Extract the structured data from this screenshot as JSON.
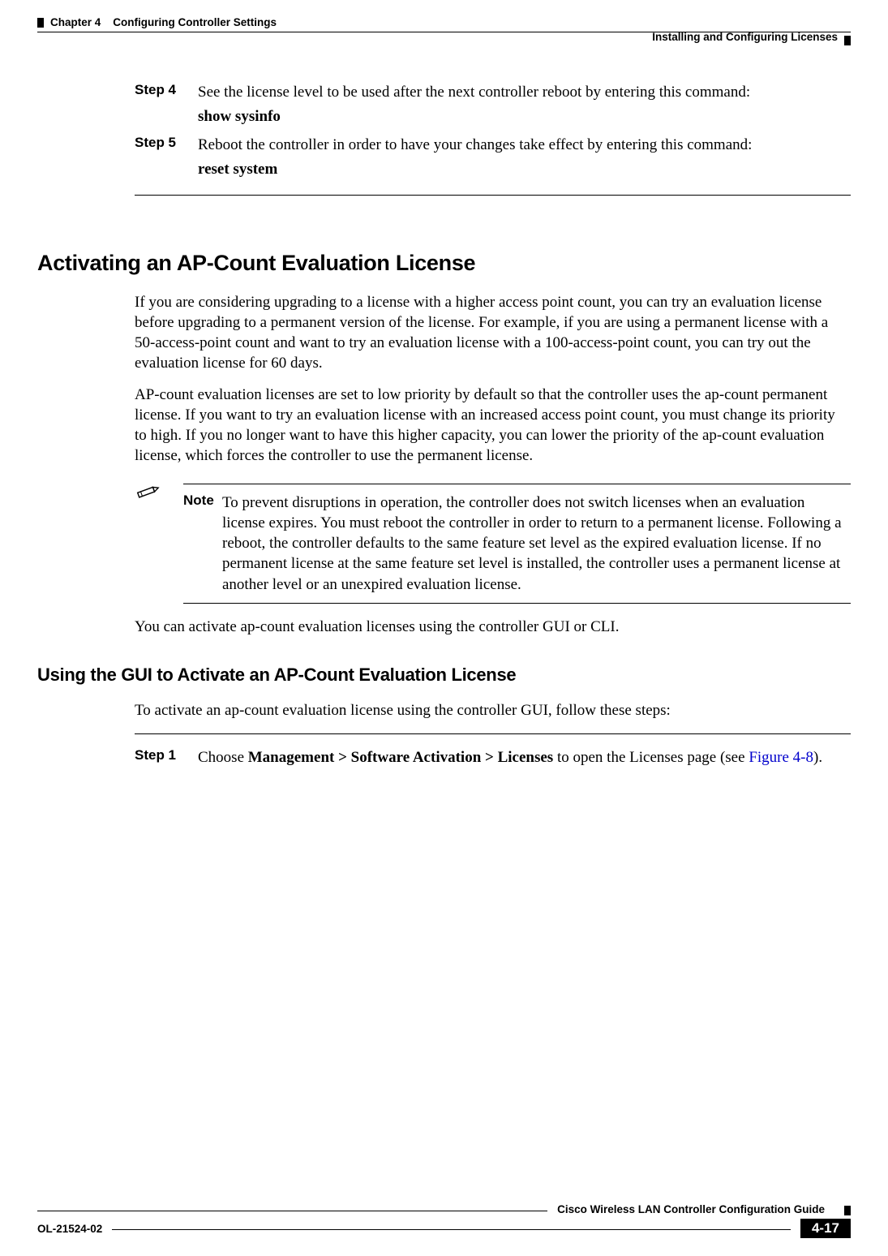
{
  "header": {
    "chapter_label": "Chapter 4",
    "chapter_title": "Configuring Controller Settings",
    "section": "Installing and Configuring Licenses"
  },
  "steps_a": [
    {
      "label": "Step 4",
      "text": "See the license level to be used after the next controller reboot by entering this command:",
      "cmd": "show sysinfo"
    },
    {
      "label": "Step 5",
      "text": "Reboot the controller in order to have your changes take effect by entering this command:",
      "cmd": "reset system"
    }
  ],
  "h1": "Activating an AP-Count Evaluation License",
  "para1": "If you are considering upgrading to a license with a higher access point count, you can try an evaluation license before upgrading to a permanent version of the license. For example, if you are using a permanent license with a 50-access-point count and want to try an evaluation license with a 100-access-point count, you can try out the evaluation license for 60 days.",
  "para2": "AP-count evaluation licenses are set to low priority by default so that the controller uses the ap-count permanent license. If you want to try an evaluation license with an increased access point count, you must change its priority to high. If you no longer want to have this higher capacity, you can lower the priority of the ap-count evaluation license, which forces the controller to use the permanent license.",
  "note": {
    "label": "Note",
    "text": "To prevent disruptions in operation, the controller does not switch licenses when an evaluation license expires. You must reboot the controller in order to return to a permanent license. Following a reboot, the controller defaults to the same feature set level as the expired evaluation license. If no permanent license at the same feature set level is installed, the controller uses a permanent license at another level or an unexpired evaluation license."
  },
  "para3": "You can activate ap-count evaluation licenses using the controller GUI or CLI.",
  "h2": "Using the GUI to Activate an AP-Count Evaluation License",
  "para4": "To activate an ap-count evaluation license using the controller GUI, follow these steps:",
  "step1": {
    "label": "Step 1",
    "prefix": "Choose ",
    "bold": "Management > Software Activation > Licenses",
    "mid": " to open the Licenses page (see ",
    "link": "Figure 4-8",
    "suffix": ")."
  },
  "footer": {
    "guide": "Cisco Wireless LAN Controller Configuration Guide",
    "ol": "OL-21524-02",
    "page": "4-17"
  }
}
